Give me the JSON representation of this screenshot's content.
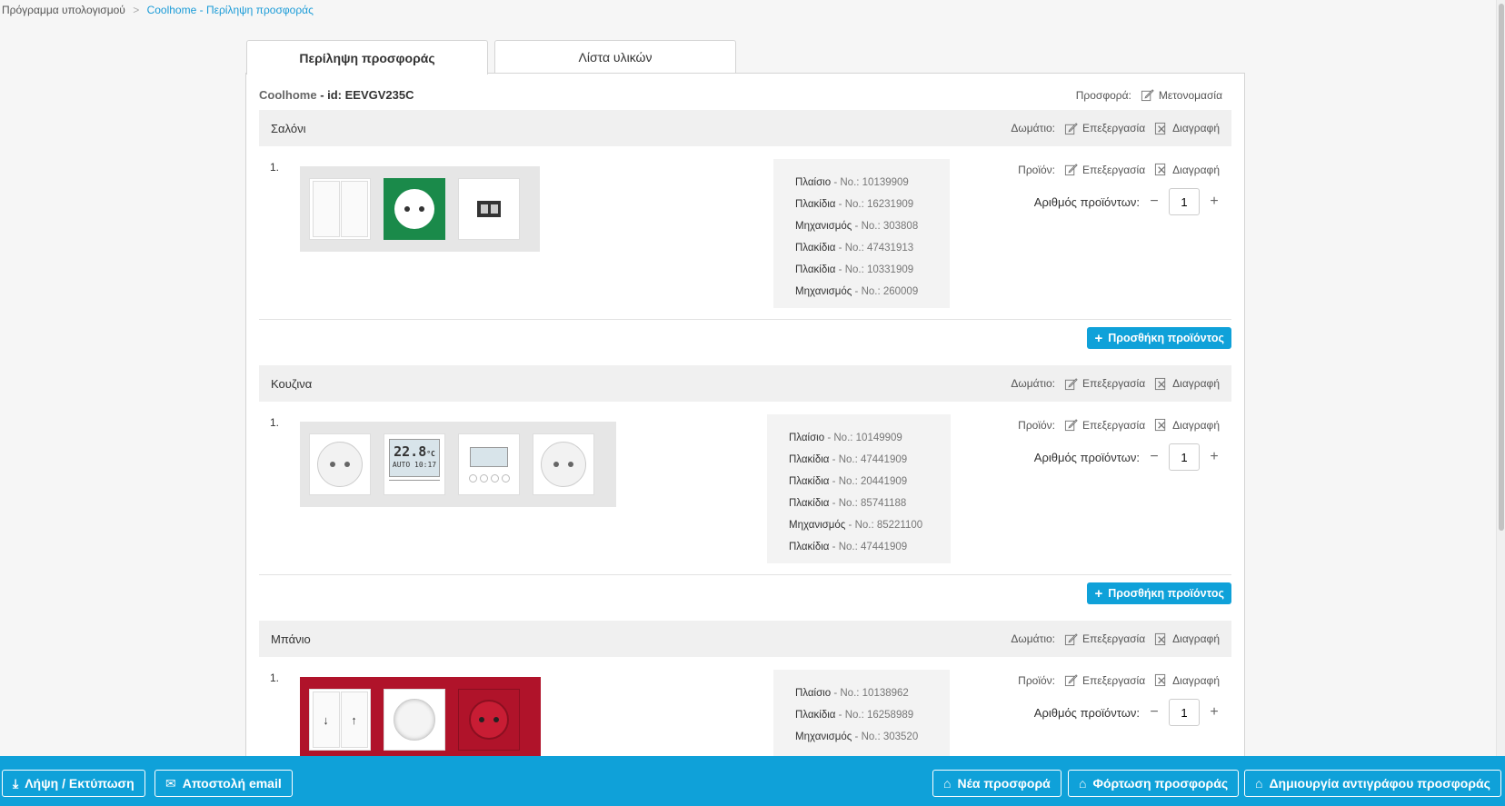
{
  "breadcrumb": {
    "root": "Πρόγραμμα υπολογισμού",
    "sep": ">",
    "current": "Coolhome - Περίληψη προσφοράς"
  },
  "tabs": [
    {
      "label": "Περίληψη προσφοράς",
      "active": true
    },
    {
      "label": "Λίστα υλικών",
      "active": false
    }
  ],
  "offer": {
    "brand": "Coolhome",
    "id_label": "- id: EEVGV235C",
    "offer_label": "Προσφορά:",
    "rename_label": "Μετονομασία"
  },
  "labels": {
    "room": "Δωμάτιο:",
    "product": "Προϊόν:",
    "edit": "Επεξεργασία",
    "delete": "Διαγραφή",
    "quantity": "Αριθμός προϊόντων:",
    "add_product": "Προσθήκη προϊόντος",
    "minus": "−",
    "plus": "+"
  },
  "rooms": [
    {
      "name": "Σαλόνι",
      "index": "1.",
      "quantity": "1",
      "items": [
        {
          "name": "Πλαίσιο",
          "no": "No.: 10139909"
        },
        {
          "name": "Πλακίδια",
          "no": "No.: 16231909"
        },
        {
          "name": "Μηχανισμός",
          "no": "No.: 303808"
        },
        {
          "name": "Πλακίδια",
          "no": "No.: 47431913"
        },
        {
          "name": "Πλακίδια",
          "no": "No.: 10331909"
        },
        {
          "name": "Μηχανισμός",
          "no": "No.: 260009"
        }
      ]
    },
    {
      "name": "Κουζινα",
      "index": "1.",
      "quantity": "1",
      "thermostat": {
        "temp": "22.8",
        "unit": "°C",
        "mode": "AUTO",
        "time": "10:17"
      },
      "items": [
        {
          "name": "Πλαίσιο",
          "no": "No.: 10149909"
        },
        {
          "name": "Πλακίδια",
          "no": "No.: 47441909"
        },
        {
          "name": "Πλακίδια",
          "no": "No.: 20441909"
        },
        {
          "name": "Πλακίδια",
          "no": "No.: 85741188"
        },
        {
          "name": "Μηχανισμός",
          "no": "No.: 85221100"
        },
        {
          "name": "Πλακίδια",
          "no": "No.: 47441909"
        }
      ]
    },
    {
      "name": "Μπάνιο",
      "index": "1.",
      "quantity": "1",
      "items": [
        {
          "name": "Πλαίσιο",
          "no": "No.: 10138962"
        },
        {
          "name": "Πλακίδια",
          "no": "No.: 16258989"
        },
        {
          "name": "Μηχανισμός",
          "no": "No.: 303520"
        }
      ]
    }
  ],
  "footer": {
    "download": "Λήψη / Εκτύπωση",
    "email": "Αποστολή email",
    "new_offer": "Νέα προσφορά",
    "load_offer": "Φόρτωση προσφοράς",
    "copy_offer": "Δημιουργία αντιγράφου προσφοράς"
  },
  "colors": {
    "accent": "#0fa1d9",
    "green_frame": "#1a8a4a",
    "red_frame": "#b0132a"
  }
}
